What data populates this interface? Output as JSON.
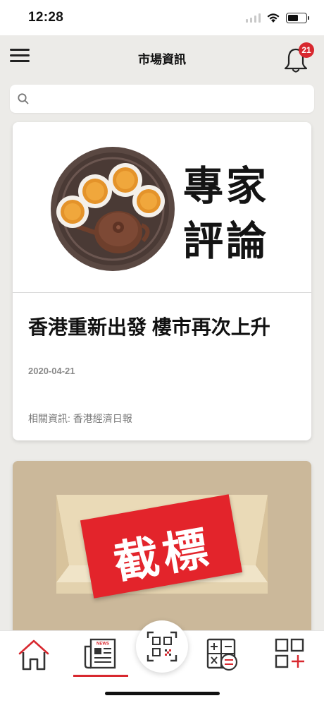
{
  "status_bar": {
    "time": "12:28"
  },
  "header": {
    "title": "市場資訊",
    "notification_count": "21"
  },
  "search": {
    "placeholder": "",
    "value": ""
  },
  "articles": [
    {
      "banner_lines": [
        "專家",
        "評論"
      ],
      "title": "香港重新出發 樓市再次上升",
      "date": "2020-04-21",
      "source": "相關資訊: 香港經濟日報"
    },
    {
      "banner_text": "截標"
    }
  ],
  "bottom_nav": {
    "items": [
      "home-icon",
      "news-icon",
      "qr-scan-icon",
      "calculator-icon",
      "add-apps-icon"
    ],
    "news_icon_label": "NEWS",
    "active": "news"
  },
  "colors": {
    "accent": "#d8282f",
    "background": "#ecebe8",
    "card": "#ffffff"
  }
}
